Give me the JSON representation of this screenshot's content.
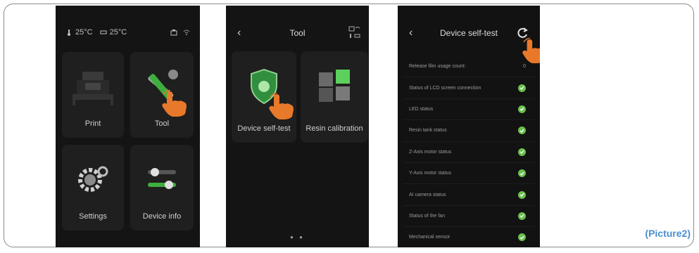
{
  "screen_home": {
    "status": {
      "temp1": "25°C",
      "temp2": "25°C"
    },
    "tiles": [
      {
        "label": "Print",
        "icon": "printer-icon"
      },
      {
        "label": "Tool",
        "icon": "tools-icon"
      },
      {
        "label": "Settings",
        "icon": "gear-icon"
      },
      {
        "label": "Device info",
        "icon": "device-info-icon"
      }
    ]
  },
  "screen_tool": {
    "title": "Tool",
    "tiles": [
      {
        "label": "Device self-test",
        "icon": "shield-icon"
      },
      {
        "label": "Resin calibration",
        "icon": "cubes-icon"
      }
    ]
  },
  "screen_selftest": {
    "title": "Device self-test",
    "rows": [
      {
        "label": "Release film usage count:",
        "value": "0"
      },
      {
        "label": "Status of LCD screen connection",
        "status": "ok"
      },
      {
        "label": "LED status",
        "status": "ok"
      },
      {
        "label": "Resin tank status",
        "status": "ok"
      },
      {
        "label": "Z-Axis motor status",
        "status": "ok"
      },
      {
        "label": "Y-Axis motor status",
        "status": "ok"
      },
      {
        "label": "AI camera status",
        "status": "ok"
      },
      {
        "label": "Status of the fan",
        "status": "ok"
      },
      {
        "label": "Mechanical sensor",
        "status": "ok"
      }
    ]
  },
  "caption": "(Picture2)",
  "colors": {
    "accent_hand": "#e8782a",
    "check": "#6abf4b",
    "caption": "#4a8fd0",
    "shield": "#2f8f3e"
  }
}
